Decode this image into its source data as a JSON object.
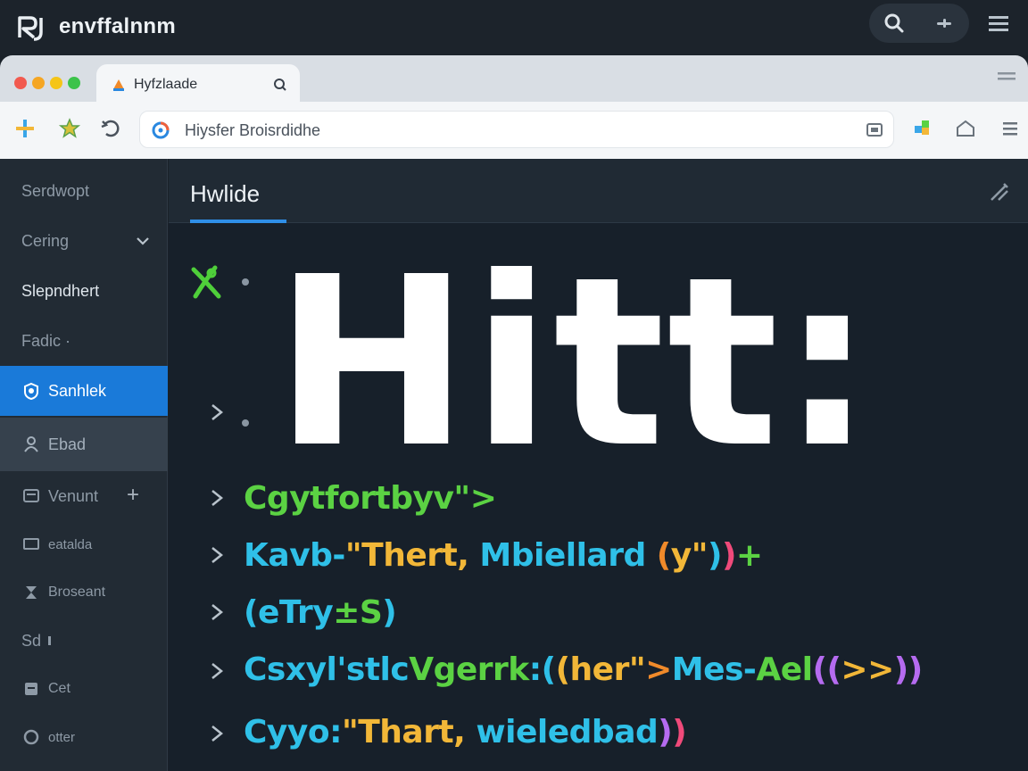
{
  "os": {
    "title": "envffalnnm",
    "logo_text": "RJ"
  },
  "browser": {
    "tab_label": "Hyfzlaade",
    "url_text": "Hiysfer Broisrdidhe"
  },
  "sidebar": {
    "items": [
      {
        "label": "Serdwopt"
      },
      {
        "label": "Cering"
      },
      {
        "label": "Slepndhert"
      },
      {
        "label": "Fadic ·"
      },
      {
        "label": "Sanhlek"
      },
      {
        "label": "Ebad"
      },
      {
        "label": "Venunt"
      },
      {
        "label": "eatalda"
      },
      {
        "label": "Broseant"
      },
      {
        "label": "Sd"
      },
      {
        "label": "Cet"
      },
      {
        "label": "otter"
      }
    ]
  },
  "main": {
    "tab_label": "Hwlide",
    "headline": "Hitt:",
    "code_lines": [
      [
        {
          "t": "Cgytfortbyv\"",
          "c": "green"
        },
        {
          "t": ">",
          "c": "green"
        }
      ],
      [
        {
          "t": "Kavb-",
          "c": "cyan"
        },
        {
          "t": "\"Thert, ",
          "c": "yellow"
        },
        {
          "t": "Mbiellard ",
          "c": "cyan"
        },
        {
          "t": "(",
          "c": "orange"
        },
        {
          "t": "y\"",
          "c": "yellow"
        },
        {
          "t": ")",
          "c": "cyan"
        },
        {
          "t": ")",
          "c": "red"
        },
        {
          "t": "+",
          "c": "green"
        }
      ],
      [
        {
          "t": "(eTry",
          "c": "cyan"
        },
        {
          "t": "±S",
          "c": "green"
        },
        {
          "t": ")",
          "c": "cyan"
        }
      ],
      [
        {
          "t": "Csxyl'stlc",
          "c": "cyan"
        },
        {
          "t": "Vgerrk",
          "c": "green"
        },
        {
          "t": ":(",
          "c": "cyan"
        },
        {
          "t": "(her\"",
          "c": "yellow"
        },
        {
          "t": ">",
          "c": "orange"
        },
        {
          "t": "Mes-",
          "c": "cyan"
        },
        {
          "t": "Ael",
          "c": "green"
        },
        {
          "t": "((",
          "c": "purple"
        },
        {
          "t": ">>",
          "c": "yellow"
        },
        {
          "t": "))",
          "c": "purple"
        }
      ],
      [
        {
          "t": "Cyyo:",
          "c": "cyan"
        },
        {
          "t": "\"Thart, ",
          "c": "yellow"
        },
        {
          "t": "wieledbad",
          "c": "cyan"
        },
        {
          "t": ")",
          "c": "purple"
        },
        {
          "t": ")",
          "c": "red"
        }
      ]
    ]
  },
  "colors": {
    "accent": "#1a7ad9",
    "code_green": "#5bd243",
    "code_cyan": "#2fc0e8",
    "code_yellow": "#f2b738"
  }
}
